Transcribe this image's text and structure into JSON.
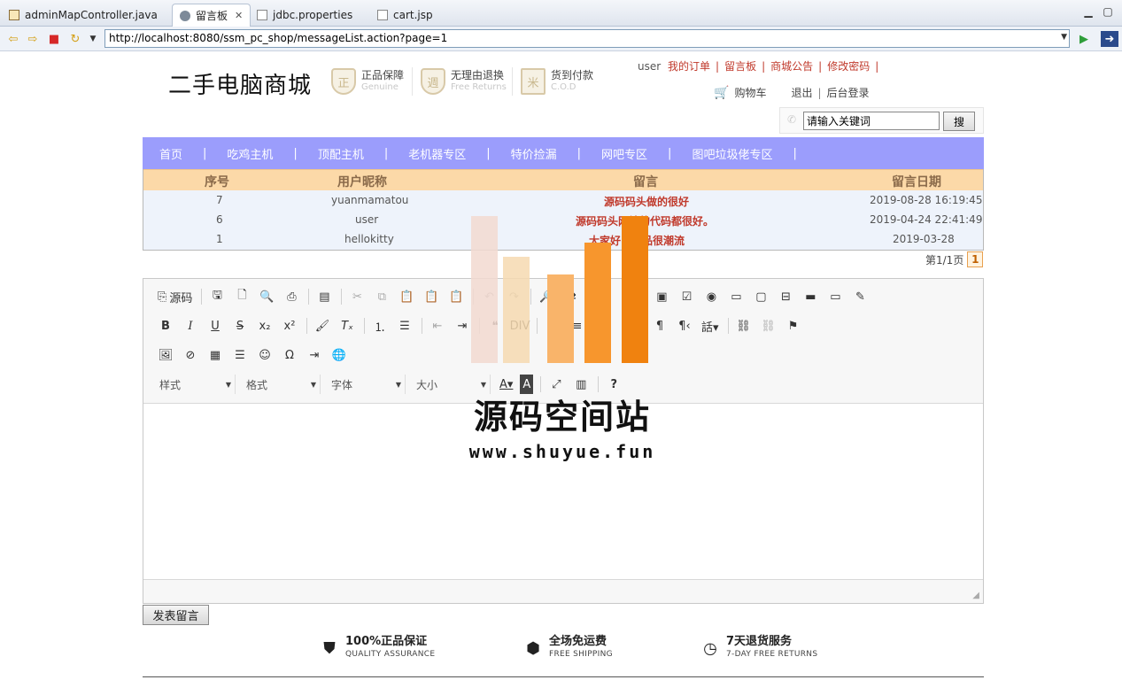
{
  "tabs": [
    {
      "label": "adminMapController.java",
      "icon": "java-file-icon",
      "active": false
    },
    {
      "label": "留言板",
      "icon": "globe-icon",
      "active": true
    },
    {
      "label": "jdbc.properties",
      "icon": "properties-file-icon",
      "active": false
    },
    {
      "label": "cart.jsp",
      "icon": "jsp-file-icon",
      "active": false
    }
  ],
  "browser": {
    "url": "http://localhost:8080/ssm_pc_shop/messageList.action?page=1"
  },
  "header": {
    "logo": "二手电脑商城",
    "badges": [
      {
        "cn": "正品保障",
        "en": "Genuine",
        "icon_char": "正"
      },
      {
        "cn": "无理由退换",
        "en": "Free Returns",
        "icon_char": "週"
      },
      {
        "cn": "货到付款",
        "en": "C.O.D",
        "icon_char": "米"
      }
    ],
    "user": "user",
    "links": [
      "我的订单",
      "留言板",
      "商城公告",
      "修改密码"
    ],
    "cart": "购物车",
    "logout": "退出",
    "admin": "后台登录",
    "search_value": "请输入关键词",
    "search_button": "搜"
  },
  "menu": [
    "首页",
    "吃鸡主机",
    "顶配主机",
    "老机器专区",
    "特价捡漏",
    "网吧专区",
    "图吧垃圾佬专区"
  ],
  "messages": {
    "headers": [
      "序号",
      "用户昵称",
      "留言",
      "留言日期"
    ],
    "rows": [
      {
        "id": "7",
        "user": "yuanmamatou",
        "msg": "源码码头做的很好",
        "date": "2019-08-28 16:19:45"
      },
      {
        "id": "6",
        "user": "user",
        "msg": "源码码头网站的代码都很好。",
        "date": "2019-04-24 22:41:49"
      },
      {
        "id": "1",
        "user": "hellokitty",
        "msg": "大家好，商品很潮流",
        "date": "2019-03-28"
      }
    ],
    "pager_text": "第1/1页",
    "current_page": "1"
  },
  "editor": {
    "source_label": "源码",
    "combos": [
      "样式",
      "格式",
      "字体",
      "大小"
    ],
    "submit": "发表留言"
  },
  "footer": [
    {
      "cn": "100%正品保证",
      "en": "QUALITY ASSURANCE",
      "icon": "shield-icon"
    },
    {
      "cn": "全场免运费",
      "en": "FREE SHIPPING",
      "icon": "box-icon"
    },
    {
      "cn": "7天退货服务",
      "en": "7-DAY FREE RETURNS",
      "icon": "clock-icon"
    }
  ],
  "watermark": {
    "text": "源码空间站",
    "url": "www.shuyue.fun"
  },
  "colors": {
    "menu_bg": "#9b9dfc",
    "table_head": "#fcd9a8",
    "accent_red": "#c0392b"
  }
}
